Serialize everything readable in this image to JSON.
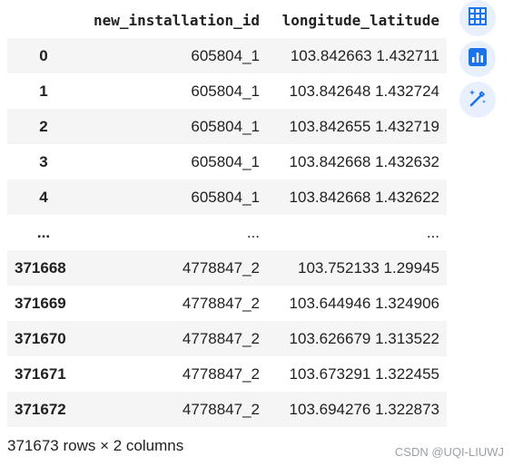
{
  "table": {
    "columns": [
      "",
      "new_installation_id",
      "longitude_latitude"
    ],
    "rows": [
      {
        "index": "0",
        "new_installation_id": "605804_1",
        "longitude_latitude": "103.842663 1.432711"
      },
      {
        "index": "1",
        "new_installation_id": "605804_1",
        "longitude_latitude": "103.842648 1.432724"
      },
      {
        "index": "2",
        "new_installation_id": "605804_1",
        "longitude_latitude": "103.842655 1.432719"
      },
      {
        "index": "3",
        "new_installation_id": "605804_1",
        "longitude_latitude": "103.842668 1.432632"
      },
      {
        "index": "4",
        "new_installation_id": "605804_1",
        "longitude_latitude": "103.842668 1.432622"
      },
      {
        "index": "...",
        "new_installation_id": "...",
        "longitude_latitude": "..."
      },
      {
        "index": "371668",
        "new_installation_id": "4778847_2",
        "longitude_latitude": "103.752133 1.29945"
      },
      {
        "index": "371669",
        "new_installation_id": "4778847_2",
        "longitude_latitude": "103.644946 1.324906"
      },
      {
        "index": "371670",
        "new_installation_id": "4778847_2",
        "longitude_latitude": "103.626679 1.313522"
      },
      {
        "index": "371671",
        "new_installation_id": "4778847_2",
        "longitude_latitude": "103.673291 1.322455"
      },
      {
        "index": "371672",
        "new_installation_id": "4778847_2",
        "longitude_latitude": "103.694276 1.322873"
      }
    ],
    "shape_text": "371673 rows × 2 columns"
  },
  "tools": [
    {
      "name": "table-icon",
      "label": "Convert to interactive table"
    },
    {
      "name": "chart-icon",
      "label": "Suggest charts"
    },
    {
      "name": "magic-wand-icon",
      "label": "Generate code"
    }
  ],
  "colors": {
    "accent": "#1a73e8",
    "tool_bg": "#e8f0fe",
    "row_stripe": "#f5f5f5"
  },
  "watermark": "CSDN @UQI-LIUWJ"
}
